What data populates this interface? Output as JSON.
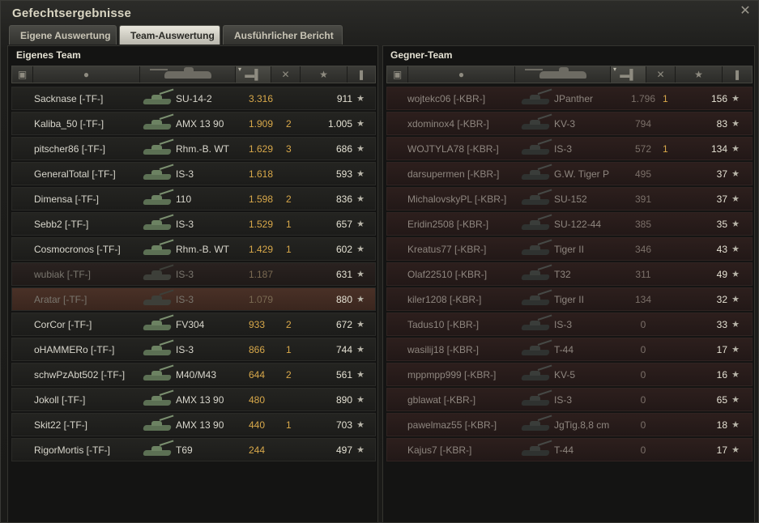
{
  "window": {
    "title": "Gefechtsergebnisse",
    "close_icon": "✕"
  },
  "tabs": [
    {
      "label": "Eigene Auswertung",
      "active": false
    },
    {
      "label": "Team-Auswertung",
      "active": true
    },
    {
      "label": "Ausführlicher Bericht",
      "active": false
    }
  ],
  "left_team": {
    "title": "Eigenes Team",
    "rows": [
      {
        "name": "Sacknase [-TF-]",
        "tank": "SU-14-2",
        "damage": "3.316",
        "kills": "",
        "xp": "911",
        "dead": false
      },
      {
        "name": "Kaliba_50 [-TF-]",
        "tank": "AMX 13 90",
        "damage": "1.909",
        "kills": "2",
        "xp": "1.005",
        "dead": false
      },
      {
        "name": "pitscher86 [-TF-]",
        "tank": "Rhm.-B. WT",
        "damage": "1.629",
        "kills": "3",
        "xp": "686",
        "dead": false
      },
      {
        "name": "GeneralTotal [-TF-]",
        "tank": "IS-3",
        "damage": "1.618",
        "kills": "",
        "xp": "593",
        "dead": false
      },
      {
        "name": "Dimensa [-TF-]",
        "tank": "110",
        "damage": "1.598",
        "kills": "2",
        "xp": "836",
        "dead": false
      },
      {
        "name": "Sebb2 [-TF-]",
        "tank": "IS-3",
        "damage": "1.529",
        "kills": "1",
        "xp": "657",
        "dead": false
      },
      {
        "name": "Cosmocronos [-TF-]",
        "tank": "Rhm.-B. WT",
        "damage": "1.429",
        "kills": "1",
        "xp": "602",
        "dead": false
      },
      {
        "name": "wubiak [-TF-]",
        "tank": "IS-3",
        "damage": "1.187",
        "kills": "",
        "xp": "631",
        "dead": true
      },
      {
        "name": "Aratar [-TF-]",
        "tank": "IS-3",
        "damage": "1.079",
        "kills": "",
        "xp": "880",
        "dead": true,
        "highlight": true
      },
      {
        "name": "CorCor [-TF-]",
        "tank": "FV304",
        "damage": "933",
        "kills": "2",
        "xp": "672",
        "dead": false
      },
      {
        "name": "oHAMMERo [-TF-]",
        "tank": "IS-3",
        "damage": "866",
        "kills": "1",
        "xp": "744",
        "dead": false
      },
      {
        "name": "schwPzAbt502 [-TF-]",
        "tank": "M40/M43",
        "damage": "644",
        "kills": "2",
        "xp": "561",
        "dead": false
      },
      {
        "name": "Jokoll [-TF-]",
        "tank": "AMX 13 90",
        "damage": "480",
        "kills": "",
        "xp": "890",
        "dead": false
      },
      {
        "name": "Skit22 [-TF-]",
        "tank": "AMX 13 90",
        "damage": "440",
        "kills": "1",
        "xp": "703",
        "dead": false
      },
      {
        "name": "RigorMortis [-TF-]",
        "tank": "T69",
        "damage": "244",
        "kills": "",
        "xp": "497",
        "dead": false
      }
    ]
  },
  "right_team": {
    "title": "Gegner-Team",
    "rows": [
      {
        "name": "wojtekc06 [-KBR-]",
        "tank": "JPanther",
        "damage": "1.796",
        "kills": "1",
        "xp": "156"
      },
      {
        "name": "xdominox4 [-KBR-]",
        "tank": "KV-3",
        "damage": "794",
        "kills": "",
        "xp": "83"
      },
      {
        "name": "WOJTYLA78 [-KBR-]",
        "tank": "IS-3",
        "damage": "572",
        "kills": "1",
        "xp": "134"
      },
      {
        "name": "darsupermen [-KBR-]",
        "tank": "G.W. Tiger P",
        "damage": "495",
        "kills": "",
        "xp": "37"
      },
      {
        "name": "MichalovskyPL [-KBR-]",
        "tank": "SU-152",
        "damage": "391",
        "kills": "",
        "xp": "37"
      },
      {
        "name": "Eridin2508 [-KBR-]",
        "tank": "SU-122-44",
        "damage": "385",
        "kills": "",
        "xp": "35"
      },
      {
        "name": "Kreatus77 [-KBR-]",
        "tank": "Tiger II",
        "damage": "346",
        "kills": "",
        "xp": "43"
      },
      {
        "name": "Olaf22510 [-KBR-]",
        "tank": "T32",
        "damage": "311",
        "kills": "",
        "xp": "49"
      },
      {
        "name": "kiler1208 [-KBR-]",
        "tank": "Tiger II",
        "damage": "134",
        "kills": "",
        "xp": "32"
      },
      {
        "name": "Tadus10 [-KBR-]",
        "tank": "IS-3",
        "damage": "0",
        "kills": "",
        "xp": "33"
      },
      {
        "name": "wasilij18 [-KBR-]",
        "tank": "T-44",
        "damage": "0",
        "kills": "",
        "xp": "17"
      },
      {
        "name": "mppmpp999 [-KBR-]",
        "tank": "KV-5",
        "damage": "0",
        "kills": "",
        "xp": "16"
      },
      {
        "name": "gblawat [-KBR-]",
        "tank": "IS-3",
        "damage": "0",
        "kills": "",
        "xp": "65"
      },
      {
        "name": "pawelmaz55 [-KBR-]",
        "tank": "JgTig.8,8 cm",
        "damage": "0",
        "kills": "",
        "xp": "18"
      },
      {
        "name": "Kajus7 [-KBR-]",
        "tank": "T-44",
        "damage": "0",
        "kills": "",
        "xp": "17"
      }
    ]
  },
  "icons": {
    "star": "★",
    "sort_caret": "▾"
  },
  "colors": {
    "damage": "#d8a84a",
    "enemy_row": "#2d1f1d",
    "highlight_row": "#4a3127"
  }
}
